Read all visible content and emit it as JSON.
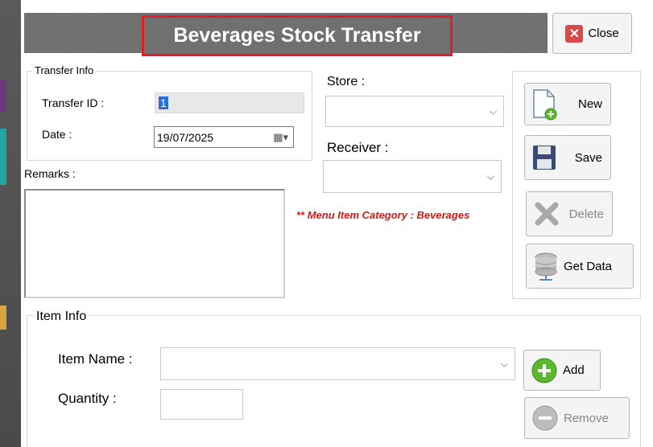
{
  "window": {
    "title": "Beverages Stock Transfer",
    "close_label": "Close"
  },
  "transfer_info": {
    "legend": "Transfer Info",
    "transfer_id_label": "Transfer ID :",
    "transfer_id_value": "1",
    "date_label": "Date :",
    "date_value": "19/07/2025"
  },
  "store": {
    "label": "Store :",
    "value": ""
  },
  "receiver": {
    "label": "Receiver :",
    "value": ""
  },
  "remarks": {
    "label": "Remarks :",
    "value": ""
  },
  "note": "** Menu Item Category : Beverages",
  "actions": {
    "new_label": "New",
    "save_label": "Save",
    "delete_label": "Delete",
    "get_data_label": "Get Data"
  },
  "item_info": {
    "legend": "Item Info",
    "item_name_label": "Item Name :",
    "item_name_value": "",
    "quantity_label": "Quantity :",
    "quantity_value": "",
    "add_label": "Add",
    "remove_label": "Remove"
  },
  "colors": {
    "title_highlight": "#e02020",
    "note": "#d01a1a",
    "accent_green": "#5cb82f"
  }
}
